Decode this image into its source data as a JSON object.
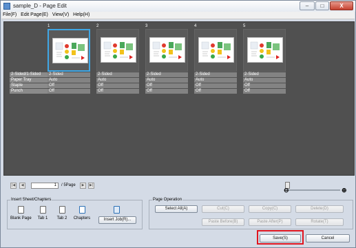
{
  "window": {
    "title": "sample_D - Page Edit",
    "min": "–",
    "max": "□",
    "close": "X"
  },
  "menus": [
    "File(F)",
    "Edit Page(E)",
    "View(V)",
    "Help(H)"
  ],
  "row_labels": [
    "2-Sided/1-Sided",
    "Paper Tray",
    "Staple",
    "Punch"
  ],
  "pages": [
    {
      "num": "1",
      "values": [
        "2-Sided",
        "Auto",
        "Off",
        "Off"
      ],
      "selected": true
    },
    {
      "num": "2",
      "values": [
        "2-Sided",
        "Auto",
        "Off",
        "Off"
      ],
      "selected": false
    },
    {
      "num": "3",
      "values": [
        "2-Sided",
        "Auto",
        "Off",
        "Off"
      ],
      "selected": false
    },
    {
      "num": "4",
      "values": [
        "2-Sided",
        "Auto",
        "Off",
        "Off"
      ],
      "selected": false
    },
    {
      "num": "5",
      "values": [
        "2-Sided",
        "Auto",
        "Off",
        "Off"
      ],
      "selected": false
    }
  ],
  "nav": {
    "first": "|◀",
    "prev": "◀",
    "next": "▶",
    "last": "▶|",
    "current_page": "1",
    "total": "/ 5Page"
  },
  "zoom": {
    "out": "⊖",
    "in": "⊕",
    "level": 0
  },
  "insert": {
    "legend": "Insert Sheet/Chapters",
    "items": [
      "Blank Page",
      "Tab 1",
      "Tab 2",
      "Chapters"
    ],
    "insert_job": "Insert Job(R)..."
  },
  "page_operation": {
    "legend": "Page Operation",
    "select_all": "Select All(A)",
    "cut": "Cut(C)",
    "copy": "Copy(C)",
    "delete": "Delete(D)",
    "paste_before": "Paste Before(B)",
    "paste_after": "Paste After(P)",
    "rotate": "Rotate(T)"
  },
  "footer": {
    "save": "Save(S)",
    "cancel": "Cancel"
  }
}
